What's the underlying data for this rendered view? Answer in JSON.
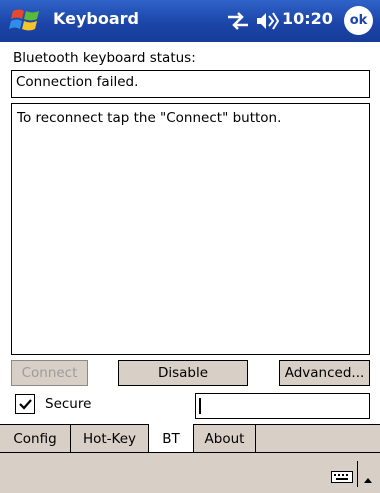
{
  "titlebar": {
    "app_title": "Keyboard",
    "clock": "10:20",
    "ok_label": "ok",
    "accent_color": "#1c45a8"
  },
  "status": {
    "label": "Bluetooth keyboard status:",
    "value": "Connection failed."
  },
  "message": {
    "text": "To reconnect tap the \"Connect\" button."
  },
  "buttons": {
    "connect": "Connect",
    "disable": "Disable",
    "advanced": "Advanced..."
  },
  "secure": {
    "label": "Secure",
    "checked": true
  },
  "tabs": [
    {
      "label": "Config",
      "active": false
    },
    {
      "label": "Hot-Key",
      "active": false
    },
    {
      "label": "BT",
      "active": true
    },
    {
      "label": "About",
      "active": false
    }
  ],
  "icons": {
    "start": "windows-flag-icon",
    "connectivity": "connectivity-arrows-icon",
    "volume": "speaker-icon",
    "keyboard": "keyboard-icon",
    "sip": "up-arrow-icon"
  }
}
